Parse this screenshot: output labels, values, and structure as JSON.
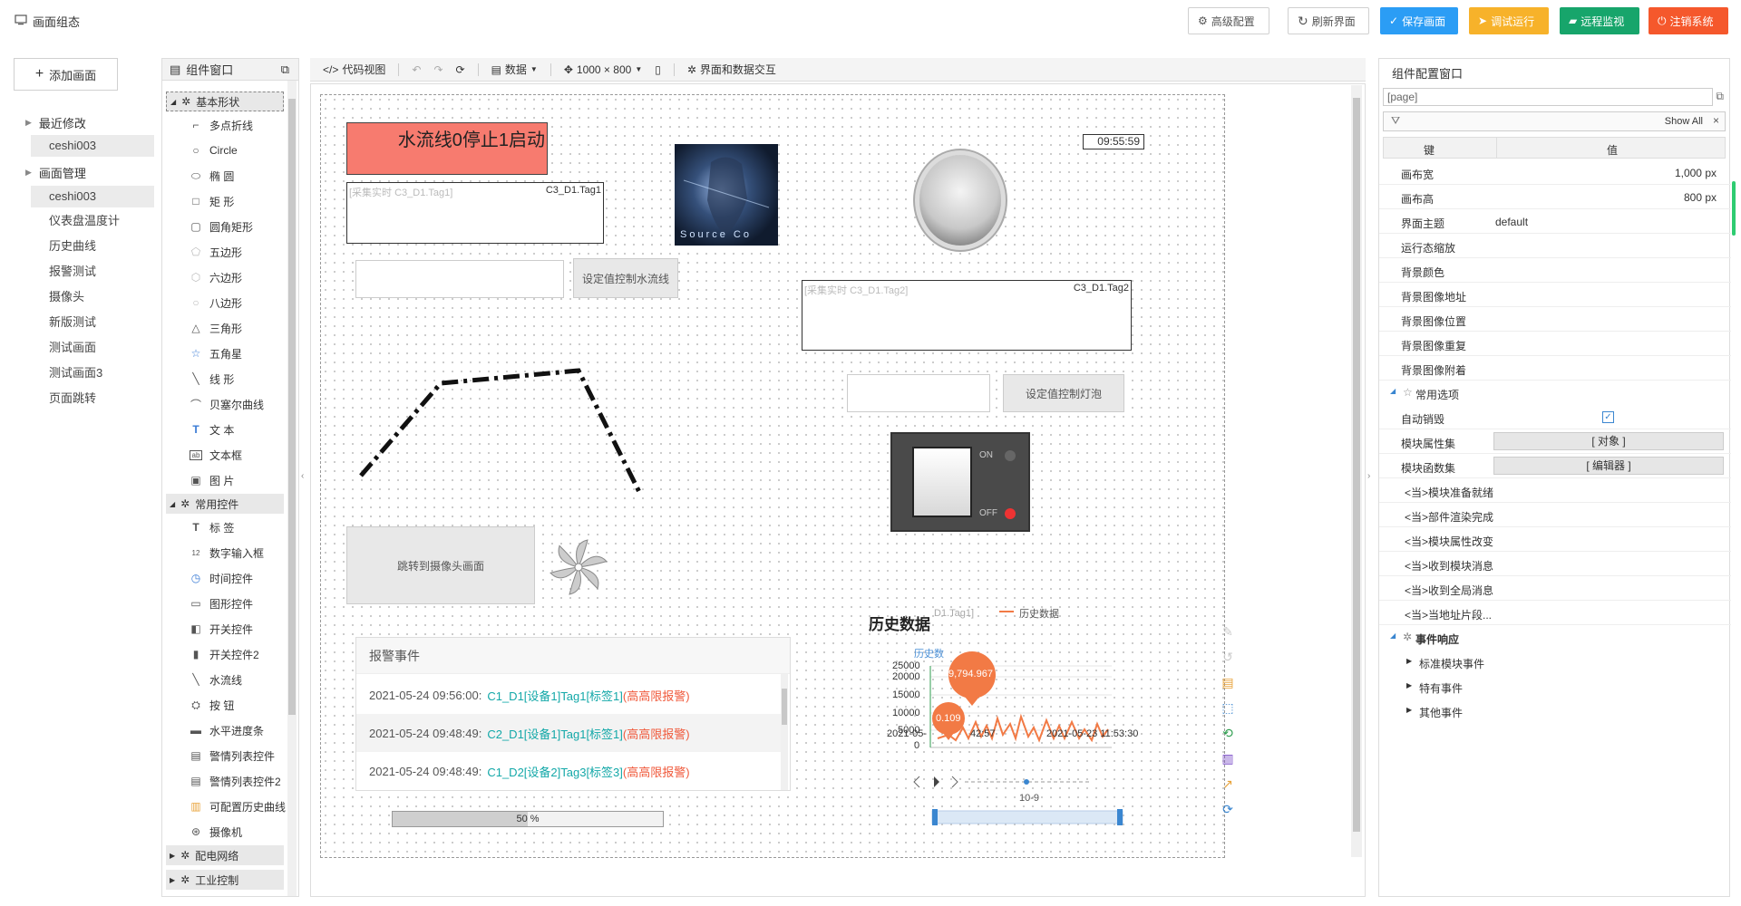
{
  "app": {
    "title": "画面组态"
  },
  "topbar": {
    "advanced_config": "高级配置",
    "refresh_view": "刷新界面",
    "save_view": "保存画面",
    "debug_run": "调试运行",
    "remote_monitor": "远程监视",
    "logout": "注销系统",
    "colors": {
      "save": "#2b9df5",
      "debug": "#f7b22a",
      "remote": "#17a56b",
      "logout": "#f5582c"
    }
  },
  "pages": {
    "add_page": "添加画面",
    "recent_label": "最近修改",
    "recent_items": [
      "ceshi003"
    ],
    "manage_label": "画面管理",
    "manage_items": [
      "ceshi003",
      "仪表盘温度计",
      "历史曲线",
      "报警测试",
      "摄像头",
      "新版测试",
      "测试画面",
      "测试画面3",
      "页面跳转"
    ]
  },
  "components": {
    "title": "组件窗口",
    "groups": [
      {
        "label": "基本形状",
        "items": [
          "多点折线",
          "Circle",
          "椭 圆",
          "矩 形",
          "圆角矩形",
          "五边形",
          "六边形",
          "八边形",
          "三角形",
          "五角星",
          "线 形",
          "贝塞尔曲线",
          "文 本",
          "文本框",
          "图 片"
        ]
      },
      {
        "label": "常用控件",
        "items": [
          "标 签",
          "数字输入框",
          "时间控件",
          "图形控件",
          "开关控件",
          "开关控件2",
          "水流线",
          "按 钮",
          "水平进度条",
          "警情列表控件",
          "警情列表控件2",
          "可配置历史曲线",
          "摄像机"
        ]
      },
      {
        "label": "配电网络",
        "items": []
      },
      {
        "label": "工业控制",
        "items": []
      }
    ]
  },
  "toolbar": {
    "code_view": "代码视图",
    "data": "数据",
    "size": "1000 × 800",
    "interaction": "界面和数据交互"
  },
  "canvas": {
    "waterflow_banner": "水流线0停止1启动",
    "clock": "09:55:59",
    "tag1_placeholder": "[采集实时 C3_D1.Tag1]",
    "tag1_value": "C3_D1.Tag1",
    "tag2_placeholder": "[采集实时 C3_D1.Tag2]",
    "tag2_value": "C3_D1.Tag2",
    "set_waterflow_button": "设定值控制水流线",
    "set_light_button": "设定值控制灯泡",
    "jump_camera_button": "跳转到摄像头画面",
    "image_caption": "Source Co",
    "switch_on": "ON",
    "switch_off": "OFF",
    "progress_percent": 50,
    "progress_label": "50 %",
    "alarm_panel": {
      "title": "报警事件",
      "rows": [
        {
          "time": "2021-05-24 09:56:00:",
          "source": "C1_D1[设备1]Tag1[标签1]",
          "level": "(高高限报警)"
        },
        {
          "time": "2021-05-24 09:48:49:",
          "source": "C2_D1[设备1]Tag1[标签1]",
          "level": "(高高限报警)"
        },
        {
          "time": "2021-05-24 09:48:49:",
          "source": "C1_D2[设备2]Tag3[标签3]",
          "level": "(高高限报警)"
        }
      ]
    },
    "history": {
      "title": "历史数据",
      "subtitle": "D1.Tag1]",
      "legend": "历史数据",
      "series_label": "历史数",
      "y_ticks": [
        "25000",
        "20000",
        "15000",
        "10000",
        "5000",
        "0"
      ],
      "x_start": "2021-05-",
      "x_mid": "42:57",
      "x_end": "2021-05-23 11:53:30",
      "max_marker": "9,794.967",
      "min_marker": "0.109",
      "slider_label": "10-9"
    }
  },
  "config": {
    "title": "组件配置窗口",
    "target": "[page]",
    "show_all": "Show All",
    "col_key": "键",
    "col_value": "值",
    "rows": [
      {
        "key": "画布宽",
        "value": "1,000 px"
      },
      {
        "key": "画布高",
        "value": "800 px"
      },
      {
        "key": "界面主题",
        "value": "default"
      },
      {
        "key": "运行态缩放",
        "value": ""
      },
      {
        "key": "背景颜色",
        "value": ""
      },
      {
        "key": "背景图像地址",
        "value": ""
      },
      {
        "key": "背景图像位置",
        "value": ""
      },
      {
        "key": "背景图像重复",
        "value": ""
      },
      {
        "key": "背景图像附着",
        "value": ""
      }
    ],
    "common_options": "常用选项",
    "auto_destroy": "自动销毁",
    "module_props": "模块属性集",
    "module_props_value": "[ 对象 ]",
    "module_funcs": "模块函数集",
    "module_funcs_value": "[ 编辑器 ]",
    "events": [
      "<当>模块准备就绪",
      "<当>部件渲染完成",
      "<当>模块属性改变",
      "<当>收到模块消息",
      "<当>收到全局消息",
      "<当>当地址片段..."
    ],
    "event_response": "事件响应",
    "sub_events": [
      "标准模块事件",
      "特有事件",
      "其他事件"
    ]
  }
}
